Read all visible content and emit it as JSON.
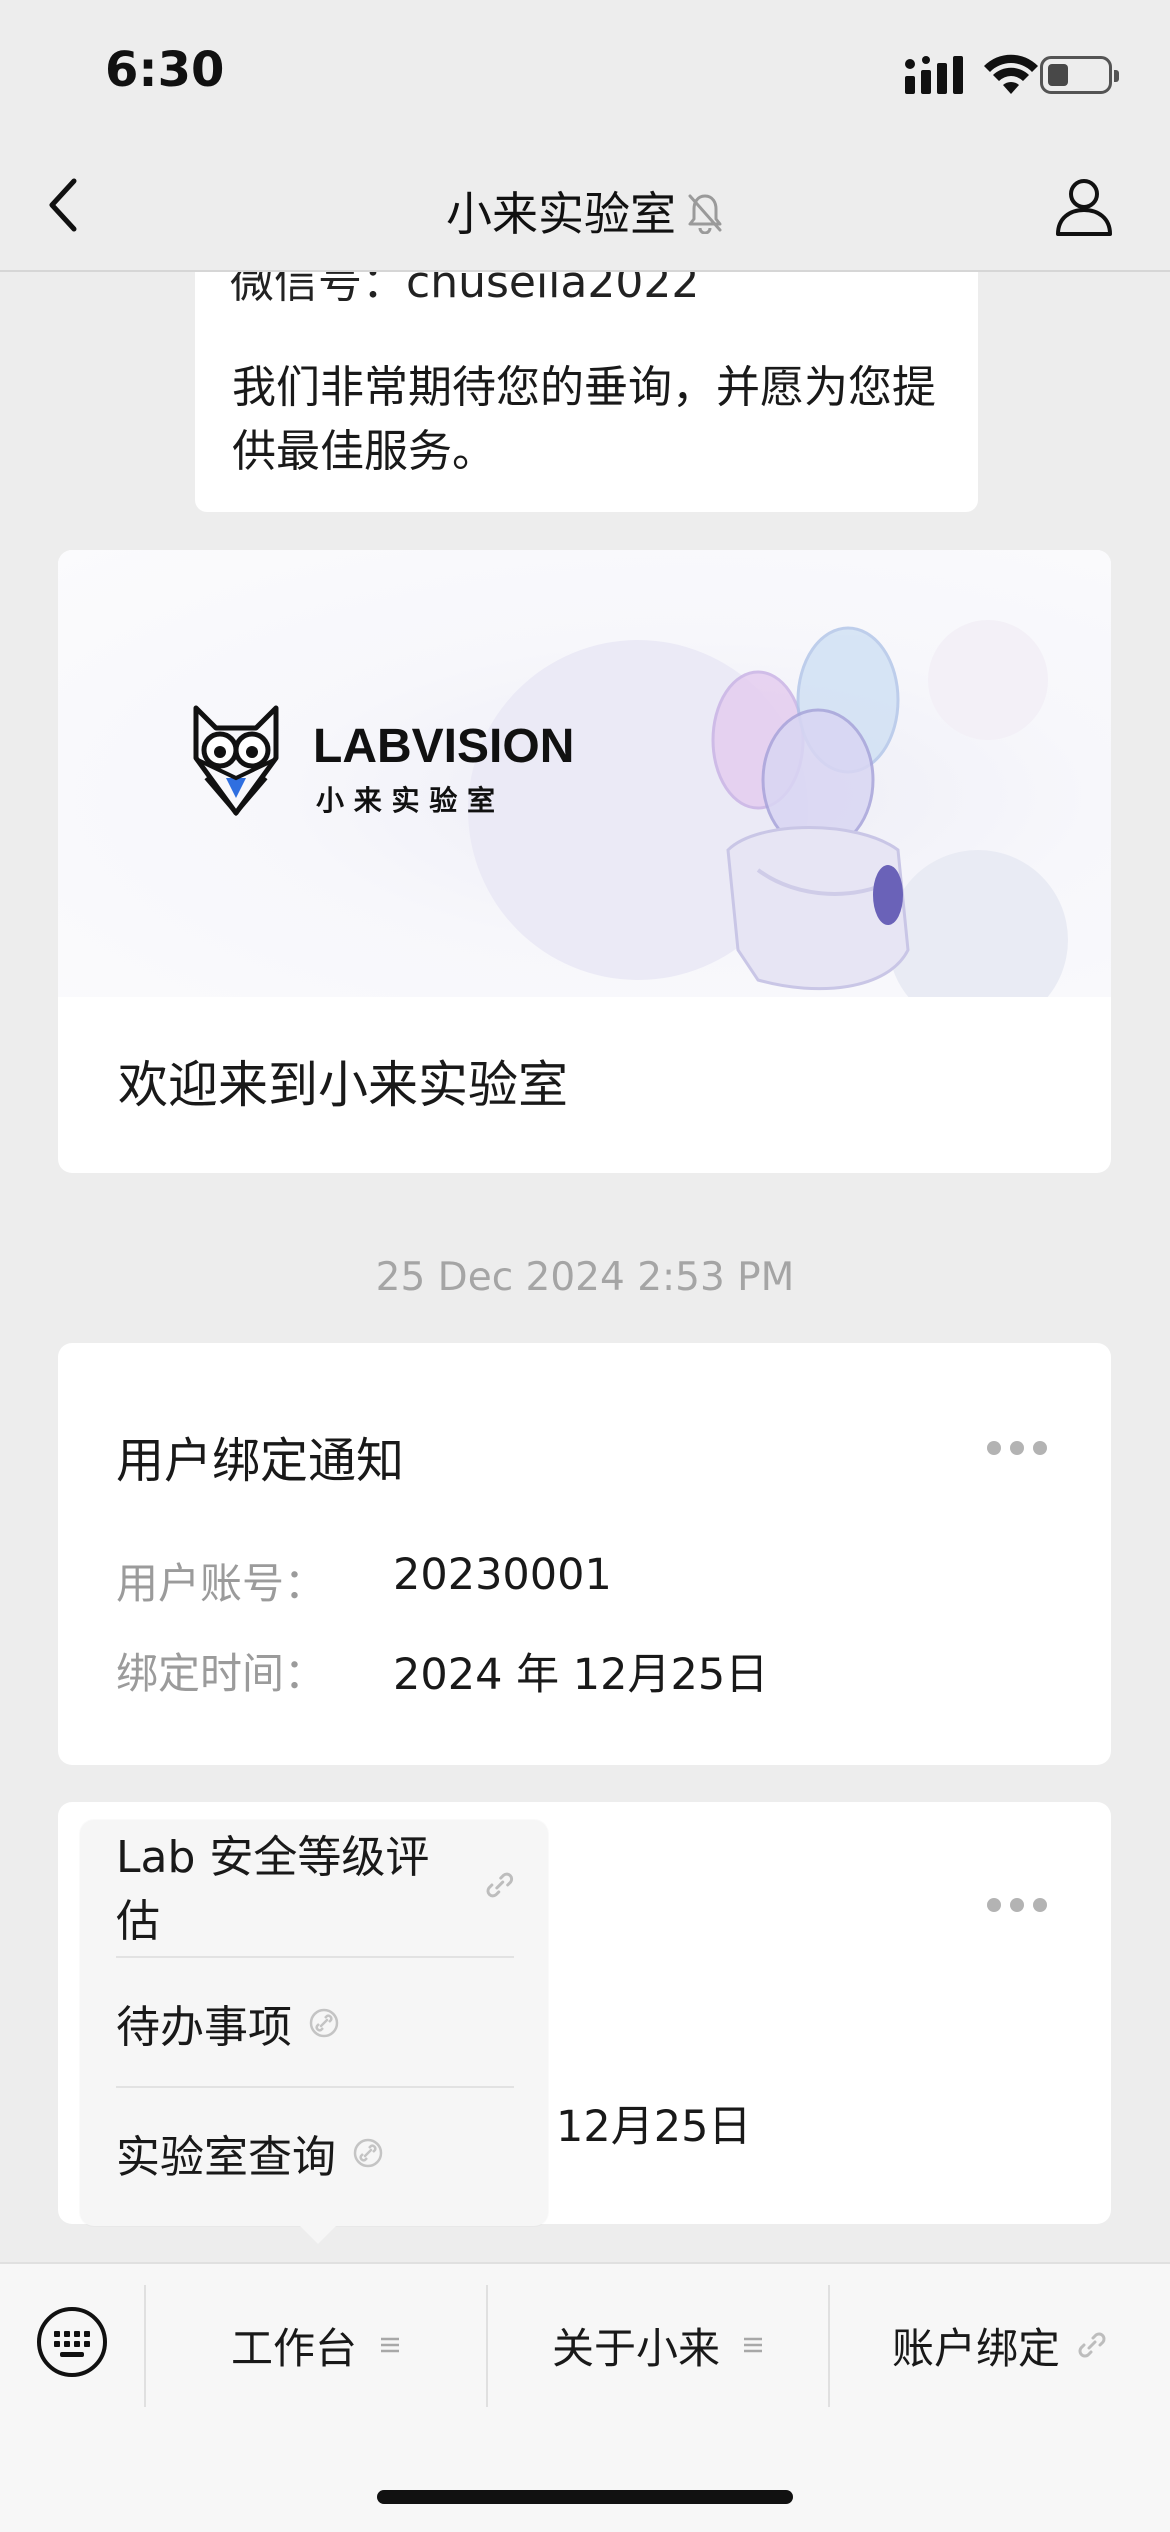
{
  "status_bar": {
    "time": "6:30"
  },
  "nav": {
    "title": "小来实验室",
    "icons": [
      "back-icon",
      "mute-bell-icon",
      "profile-icon"
    ]
  },
  "messages": {
    "bubble_cut_text": "微信号：chuseila2022",
    "bubble_text": "我们非常期待您的垂询，并愿为您提供最佳服务。",
    "banner": {
      "logo_text": "LABVISION",
      "logo_subtext": "小 来 实 验 室",
      "caption": "欢迎来到小来实验室"
    },
    "timestamp": "25 Dec 2024 2:53 PM"
  },
  "notice_card": {
    "title": "用户绑定通知",
    "fields": [
      {
        "label": "用户账号：",
        "value": "20230001"
      },
      {
        "label": "绑定时间：",
        "value": "2024 年 12月25日"
      }
    ]
  },
  "second_card": {
    "partial_value": "12月25日"
  },
  "popup_menu": {
    "items": [
      {
        "label": "Lab 安全等级评估",
        "icon": "link-icon"
      },
      {
        "label": "待办事项",
        "icon": "link-icon"
      },
      {
        "label": "实验室查询",
        "icon": "link-icon"
      }
    ]
  },
  "bottom_menu": {
    "items": [
      {
        "label": "工作台",
        "icon": "menu-lines-icon"
      },
      {
        "label": "关于小来",
        "icon": "menu-lines-icon"
      },
      {
        "label": "账户绑定",
        "icon": "link-icon"
      }
    ]
  },
  "colors": {
    "background": "#ededed",
    "card": "#ffffff",
    "muted_text": "#9b9b9b",
    "timestamp": "#a5a5a5",
    "accent_blue": "#2f6fe0"
  }
}
